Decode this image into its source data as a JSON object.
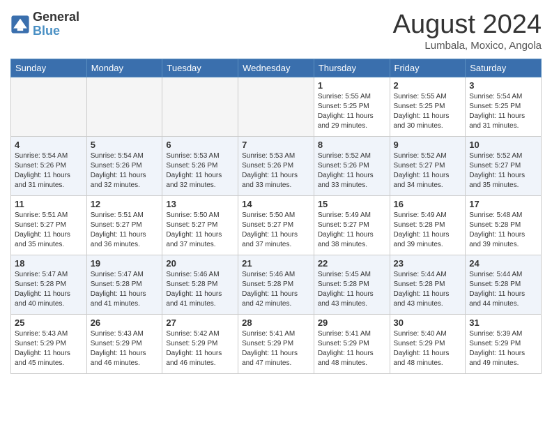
{
  "header": {
    "logo_line1": "General",
    "logo_line2": "Blue",
    "month_title": "August 2024",
    "location": "Lumbala, Moxico, Angola"
  },
  "weekdays": [
    "Sunday",
    "Monday",
    "Tuesday",
    "Wednesday",
    "Thursday",
    "Friday",
    "Saturday"
  ],
  "rows": [
    {
      "alt": false,
      "cells": [
        {
          "empty": true,
          "day": "",
          "info": ""
        },
        {
          "empty": true,
          "day": "",
          "info": ""
        },
        {
          "empty": true,
          "day": "",
          "info": ""
        },
        {
          "empty": true,
          "day": "",
          "info": ""
        },
        {
          "empty": false,
          "day": "1",
          "info": "Sunrise: 5:55 AM\nSunset: 5:25 PM\nDaylight: 11 hours\nand 29 minutes."
        },
        {
          "empty": false,
          "day": "2",
          "info": "Sunrise: 5:55 AM\nSunset: 5:25 PM\nDaylight: 11 hours\nand 30 minutes."
        },
        {
          "empty": false,
          "day": "3",
          "info": "Sunrise: 5:54 AM\nSunset: 5:25 PM\nDaylight: 11 hours\nand 31 minutes."
        }
      ]
    },
    {
      "alt": true,
      "cells": [
        {
          "empty": false,
          "day": "4",
          "info": "Sunrise: 5:54 AM\nSunset: 5:26 PM\nDaylight: 11 hours\nand 31 minutes."
        },
        {
          "empty": false,
          "day": "5",
          "info": "Sunrise: 5:54 AM\nSunset: 5:26 PM\nDaylight: 11 hours\nand 32 minutes."
        },
        {
          "empty": false,
          "day": "6",
          "info": "Sunrise: 5:53 AM\nSunset: 5:26 PM\nDaylight: 11 hours\nand 32 minutes."
        },
        {
          "empty": false,
          "day": "7",
          "info": "Sunrise: 5:53 AM\nSunset: 5:26 PM\nDaylight: 11 hours\nand 33 minutes."
        },
        {
          "empty": false,
          "day": "8",
          "info": "Sunrise: 5:52 AM\nSunset: 5:26 PM\nDaylight: 11 hours\nand 33 minutes."
        },
        {
          "empty": false,
          "day": "9",
          "info": "Sunrise: 5:52 AM\nSunset: 5:27 PM\nDaylight: 11 hours\nand 34 minutes."
        },
        {
          "empty": false,
          "day": "10",
          "info": "Sunrise: 5:52 AM\nSunset: 5:27 PM\nDaylight: 11 hours\nand 35 minutes."
        }
      ]
    },
    {
      "alt": false,
      "cells": [
        {
          "empty": false,
          "day": "11",
          "info": "Sunrise: 5:51 AM\nSunset: 5:27 PM\nDaylight: 11 hours\nand 35 minutes."
        },
        {
          "empty": false,
          "day": "12",
          "info": "Sunrise: 5:51 AM\nSunset: 5:27 PM\nDaylight: 11 hours\nand 36 minutes."
        },
        {
          "empty": false,
          "day": "13",
          "info": "Sunrise: 5:50 AM\nSunset: 5:27 PM\nDaylight: 11 hours\nand 37 minutes."
        },
        {
          "empty": false,
          "day": "14",
          "info": "Sunrise: 5:50 AM\nSunset: 5:27 PM\nDaylight: 11 hours\nand 37 minutes."
        },
        {
          "empty": false,
          "day": "15",
          "info": "Sunrise: 5:49 AM\nSunset: 5:27 PM\nDaylight: 11 hours\nand 38 minutes."
        },
        {
          "empty": false,
          "day": "16",
          "info": "Sunrise: 5:49 AM\nSunset: 5:28 PM\nDaylight: 11 hours\nand 39 minutes."
        },
        {
          "empty": false,
          "day": "17",
          "info": "Sunrise: 5:48 AM\nSunset: 5:28 PM\nDaylight: 11 hours\nand 39 minutes."
        }
      ]
    },
    {
      "alt": true,
      "cells": [
        {
          "empty": false,
          "day": "18",
          "info": "Sunrise: 5:47 AM\nSunset: 5:28 PM\nDaylight: 11 hours\nand 40 minutes."
        },
        {
          "empty": false,
          "day": "19",
          "info": "Sunrise: 5:47 AM\nSunset: 5:28 PM\nDaylight: 11 hours\nand 41 minutes."
        },
        {
          "empty": false,
          "day": "20",
          "info": "Sunrise: 5:46 AM\nSunset: 5:28 PM\nDaylight: 11 hours\nand 41 minutes."
        },
        {
          "empty": false,
          "day": "21",
          "info": "Sunrise: 5:46 AM\nSunset: 5:28 PM\nDaylight: 11 hours\nand 42 minutes."
        },
        {
          "empty": false,
          "day": "22",
          "info": "Sunrise: 5:45 AM\nSunset: 5:28 PM\nDaylight: 11 hours\nand 43 minutes."
        },
        {
          "empty": false,
          "day": "23",
          "info": "Sunrise: 5:44 AM\nSunset: 5:28 PM\nDaylight: 11 hours\nand 43 minutes."
        },
        {
          "empty": false,
          "day": "24",
          "info": "Sunrise: 5:44 AM\nSunset: 5:28 PM\nDaylight: 11 hours\nand 44 minutes."
        }
      ]
    },
    {
      "alt": false,
      "cells": [
        {
          "empty": false,
          "day": "25",
          "info": "Sunrise: 5:43 AM\nSunset: 5:29 PM\nDaylight: 11 hours\nand 45 minutes."
        },
        {
          "empty": false,
          "day": "26",
          "info": "Sunrise: 5:43 AM\nSunset: 5:29 PM\nDaylight: 11 hours\nand 46 minutes."
        },
        {
          "empty": false,
          "day": "27",
          "info": "Sunrise: 5:42 AM\nSunset: 5:29 PM\nDaylight: 11 hours\nand 46 minutes."
        },
        {
          "empty": false,
          "day": "28",
          "info": "Sunrise: 5:41 AM\nSunset: 5:29 PM\nDaylight: 11 hours\nand 47 minutes."
        },
        {
          "empty": false,
          "day": "29",
          "info": "Sunrise: 5:41 AM\nSunset: 5:29 PM\nDaylight: 11 hours\nand 48 minutes."
        },
        {
          "empty": false,
          "day": "30",
          "info": "Sunrise: 5:40 AM\nSunset: 5:29 PM\nDaylight: 11 hours\nand 48 minutes."
        },
        {
          "empty": false,
          "day": "31",
          "info": "Sunrise: 5:39 AM\nSunset: 5:29 PM\nDaylight: 11 hours\nand 49 minutes."
        }
      ]
    }
  ]
}
